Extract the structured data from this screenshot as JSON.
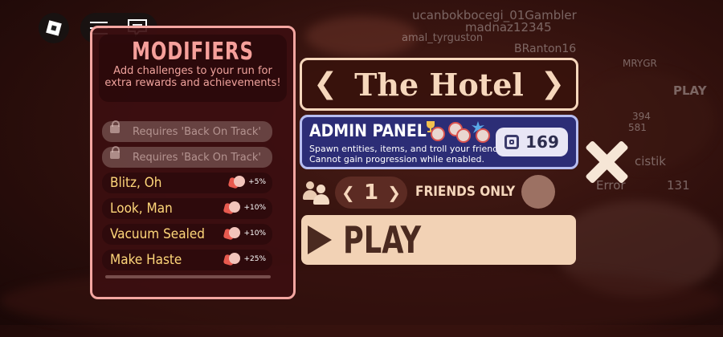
{
  "colors": {
    "panel_border": "#f4a6a1",
    "modifier_title": "#f6a09b",
    "modifier_active_text": "#ffd77a",
    "map_border": "#f6d7bc",
    "admin_bg": "#2c2d76",
    "admin_border": "#b7bdf0",
    "play_bg": "#f2d2b5",
    "play_text": "#4a2a20"
  },
  "background": {
    "player_names": [
      "ucanbokbocegi_01Gambler",
      "madnaz12345",
      "amal_tyrguston",
      "BRanton16",
      "MRYGR",
      "394",
      "581",
      "cistik",
      "Error",
      "131",
      "PLAY"
    ]
  },
  "topbar": {
    "roblox_icon": "roblox-logo-icon",
    "menu_icon": "hamburger-menu-icon",
    "chat_icon": "chat-icon"
  },
  "modifiers": {
    "title": "MODIFIERS",
    "subtitle": "Add challenges to your run for extra rewards and achievements!",
    "locked": [
      {
        "label": "Requires 'Back On Track'"
      },
      {
        "label": "Requires 'Back On Track'"
      }
    ],
    "items": [
      {
        "label": "Blitz, Oh",
        "bonus": "+5%"
      },
      {
        "label": "Look, Man",
        "bonus": "+10%"
      },
      {
        "label": "Vacuum Sealed",
        "bonus": "+10%"
      },
      {
        "label": "Make Haste",
        "bonus": "+25%"
      }
    ]
  },
  "map": {
    "left_arrow": "❮",
    "name": "The Hotel",
    "right_arrow": "❯"
  },
  "admin": {
    "title": "ADMIN PANEL",
    "desc_line1": "Spawn entities, items, and troll your friends!",
    "desc_line2": "Cannot gain progression while enabled.",
    "price": "169"
  },
  "lobby": {
    "count": "1",
    "left_arrow": "❮",
    "right_arrow": "❯",
    "friends_label": "FRIENDS ONLY",
    "friends_only_enabled": false
  },
  "play": {
    "label": "PLAY"
  }
}
